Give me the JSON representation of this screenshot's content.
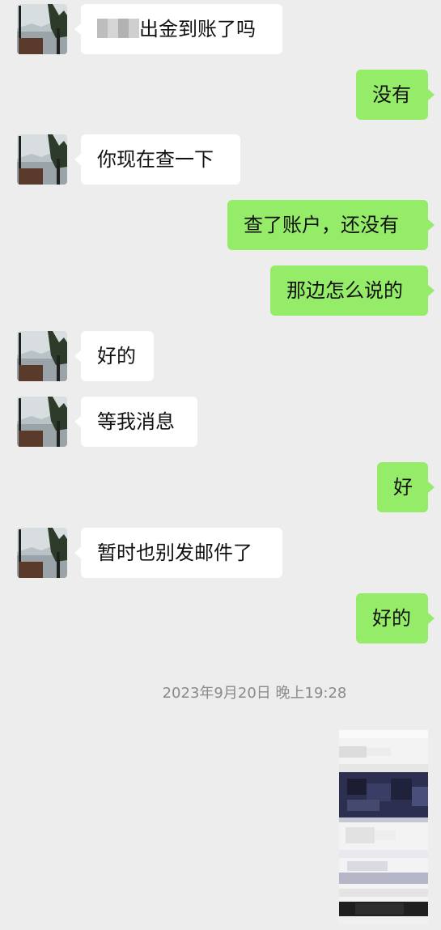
{
  "messages": [
    {
      "side": "in",
      "prefix_redacted": true,
      "text": "出金到账了吗"
    },
    {
      "side": "out",
      "text": "没有"
    },
    {
      "side": "in",
      "text": "你现在查一下"
    },
    {
      "side": "out",
      "text": "查了账户，还没有"
    },
    {
      "side": "out",
      "text": "那边怎么说的"
    },
    {
      "side": "in",
      "text": "好的"
    },
    {
      "side": "in",
      "text": "等我消息"
    },
    {
      "side": "out",
      "text": "好"
    },
    {
      "side": "in",
      "text": "暂时也别发邮件了"
    },
    {
      "side": "out",
      "text": "好的"
    }
  ],
  "timestamp": "2023年9月20日 晚上19:28",
  "colors": {
    "background": "#ededed",
    "incoming_bubble": "#ffffff",
    "outgoing_bubble": "#95ec69",
    "timestamp_text": "#8a8a8a"
  },
  "icons": {
    "contact_avatar": "avatar-image",
    "image_message": "image-thumbnail"
  }
}
